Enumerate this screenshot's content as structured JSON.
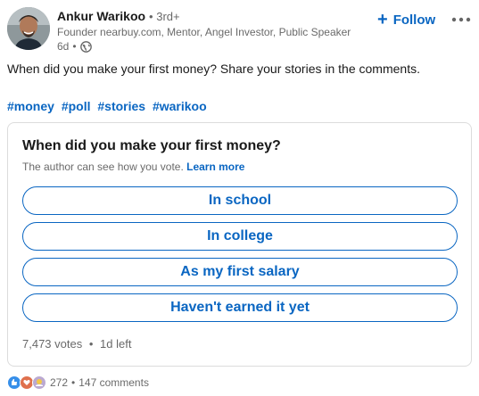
{
  "post": {
    "author": {
      "name": "Ankur Warikoo",
      "degree": "• 3rd+",
      "headline": "Founder nearbuy.com, Mentor, Angel Investor, Public Speaker",
      "time": "6d",
      "dot": "•",
      "visibility_icon": "globe-icon"
    },
    "follow": {
      "plus": "+",
      "label": "Follow"
    },
    "more_icon": "more-options-icon",
    "text": "When did you make your first money? Share your stories in the comments.",
    "hashtags": [
      "#money",
      "#poll",
      "#stories",
      "#warikoo"
    ]
  },
  "poll": {
    "question": "When did you make your first money?",
    "note": "The author can see how you vote.",
    "learn_more": "Learn more",
    "options": [
      "In school",
      "In college",
      "As my first salary",
      "Haven't earned it yet"
    ],
    "votes": "7,473 votes",
    "dot": "•",
    "time_left": "1d left"
  },
  "social": {
    "reaction_icons": [
      "like-reaction-icon",
      "love-reaction-icon",
      "support-reaction-icon"
    ],
    "reactions_count": "272",
    "dot": "•",
    "comments": "147 comments"
  },
  "colors": {
    "accent": "#0a66c2",
    "border": "#dcdcdc",
    "like": "#378fe9",
    "love": "#df704d",
    "support": "#bba9d1"
  }
}
